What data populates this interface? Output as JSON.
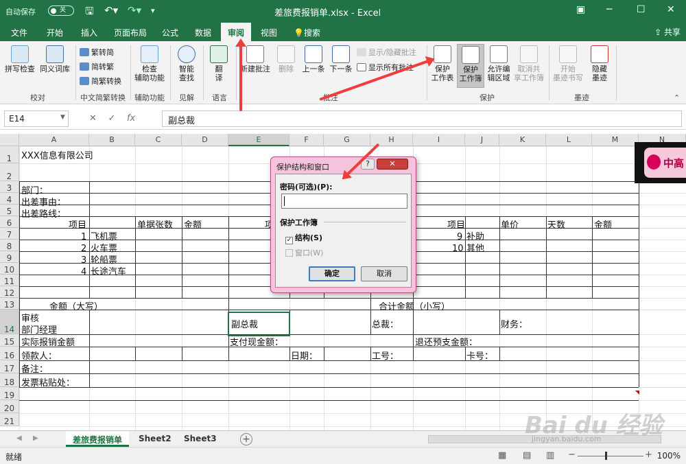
{
  "titlebar": {
    "autosave": "自动保存",
    "toggle": "关",
    "title": "差旅费报销单.xlsx - Excel"
  },
  "menu": {
    "tabs": [
      "文件",
      "开始",
      "插入",
      "页面布局",
      "公式",
      "数据",
      "审阅",
      "视图",
      "搜索"
    ],
    "active": "审阅",
    "share": "共享"
  },
  "ribbon": {
    "proof": {
      "spell": "拼写检查",
      "thesaurus": "同义词库",
      "group": "校对"
    },
    "chinese": {
      "t2s": "繁转简",
      "s2t": "简转繁",
      "conv": "简繁转换",
      "group": "中文简繁转换"
    },
    "check": {
      "label": "检查\n辅助功能",
      "group": "辅助功能"
    },
    "insight": {
      "label": "智能\n查找",
      "group": "见解"
    },
    "lang": {
      "label": "翻\n译",
      "group": "语言"
    },
    "comments": {
      "new": "新建批注",
      "delete": "删除",
      "prev": "上一条",
      "next": "下一条",
      "show_hide": "显示/隐藏批注",
      "show_all": "显示所有批注",
      "group": "批注"
    },
    "protect": {
      "sheet": "保护\n工作表",
      "workbook": "保护\n工作簿",
      "allow": "允许编\n辑区域",
      "unshare": "取消共\n享工作簿",
      "group": "保护"
    },
    "ink": {
      "start": "开始\n墨迹书写",
      "hide": "隐藏\n墨迹",
      "group": "墨迹"
    }
  },
  "formula_bar": {
    "name_box": "E14",
    "fx": "fx",
    "value": "副总裁"
  },
  "columns": [
    "A",
    "B",
    "C",
    "D",
    "E",
    "F",
    "G",
    "H",
    "I",
    "J",
    "K",
    "L",
    "M",
    "N"
  ],
  "rows": [
    "1",
    "2",
    "3",
    "4",
    "5",
    "6",
    "7",
    "8",
    "9",
    "10",
    "11",
    "12",
    "13",
    "14",
    "15",
    "16",
    "17",
    "18",
    "19",
    "20",
    "21"
  ],
  "cells": {
    "a1": "XXX信息有限公司",
    "a3": "部门：",
    "a4": "出差事由：",
    "a5": "出差路线：",
    "a6": "项目",
    "c6": "单据张数",
    "d6": "金额",
    "e6": "项",
    "i6": "项目",
    "k6": "单价",
    "l6": "天数",
    "m6": "金额",
    "n7": "1",
    "t7": "飞机票",
    "n8": "2",
    "t8": "火车票",
    "n9": "3",
    "t9": "轮船票",
    "n10": "4",
    "t10": "长途汽车",
    "n9b": "9",
    "t9b": "补助",
    "n10b": "10",
    "t10b": "其他",
    "a13": "金额（大写）",
    "h13": "合计金额（小写）",
    "a14a": "审核",
    "a14b": "部门经理",
    "e14": "副总裁",
    "h14": "总裁：",
    "k14": "财务：",
    "a15": "实际报销金额",
    "e15": "支付现金额：",
    "i15": "退还预支金额：",
    "a16": "领款人：",
    "f16": "日期：",
    "h16": "工号：",
    "j16": "卡号：",
    "a17": "备注：",
    "a18": "发票粘贴处："
  },
  "overlay_badge": "中高",
  "dialog": {
    "title": "保护结构和窗口",
    "help": "?",
    "close": "✕",
    "password_label": "密码(可选)(P):",
    "password_value": "",
    "group": "保护工作簿",
    "structure": "结构(S)",
    "structure_checked": true,
    "window": "窗口(W)",
    "window_checked": false,
    "ok": "确定",
    "cancel": "取消"
  },
  "sheets": {
    "tabs": [
      "差旅费报销单",
      "Sheet2",
      "Sheet3"
    ],
    "active": "差旅费报销单"
  },
  "status": {
    "ready": "就绪",
    "zoom": "100%"
  },
  "watermark": {
    "logo": "Bai du 经验",
    "url": "jingyan.baidu.com"
  },
  "colors": {
    "excel_green": "#217346",
    "arrow_red": "#ef3d3d",
    "dialog_pink": "#f3c4dc"
  }
}
